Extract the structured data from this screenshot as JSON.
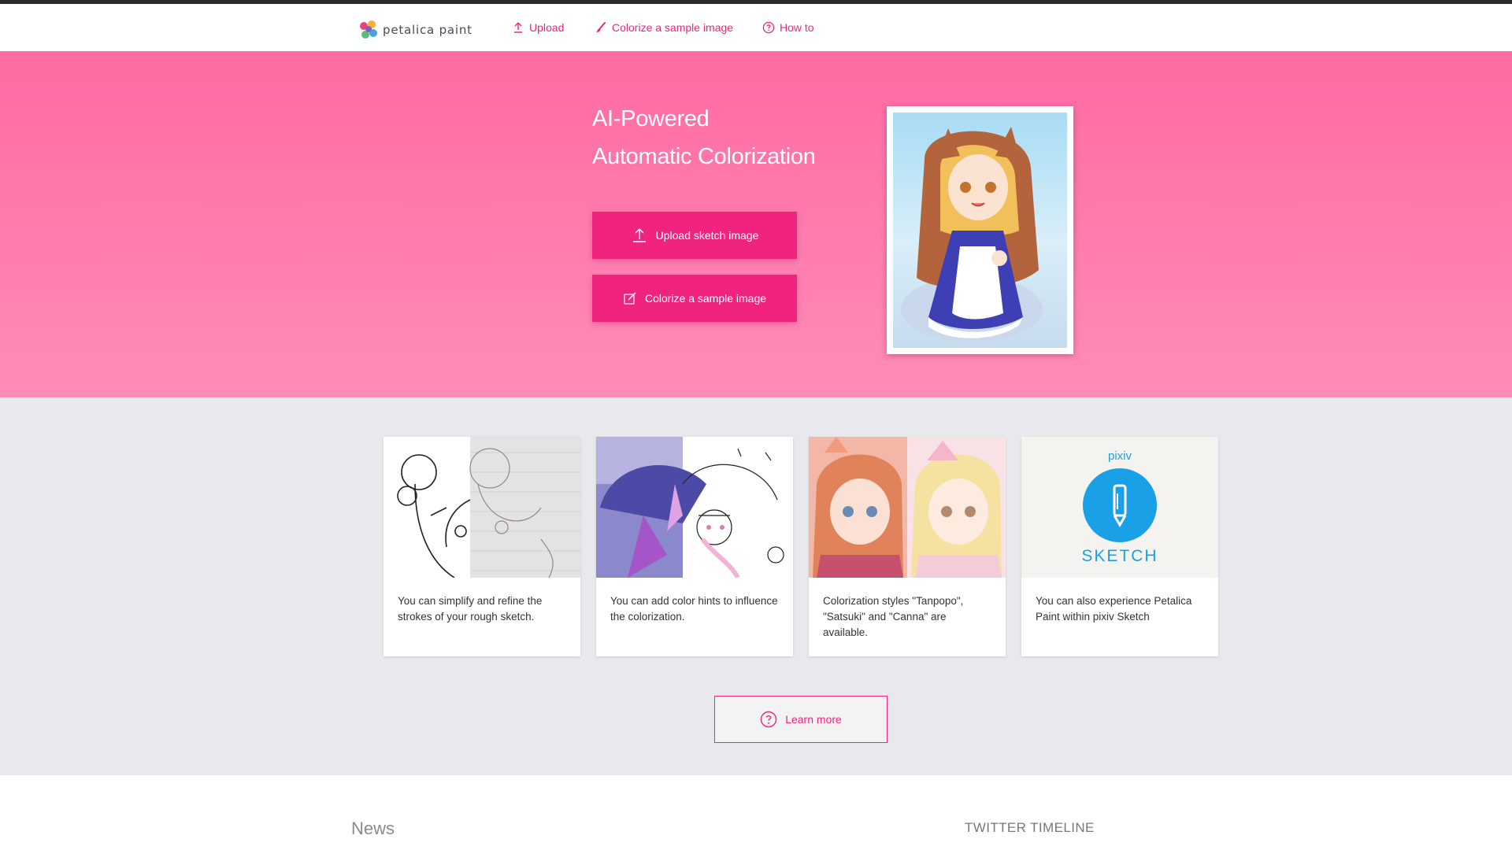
{
  "header": {
    "logo_text": "petalica paint",
    "nav": [
      {
        "label": "Upload",
        "icon": "upload-icon"
      },
      {
        "label": "Colorize a sample image",
        "icon": "brush-icon"
      },
      {
        "label": "How to",
        "icon": "question-circle-icon"
      }
    ]
  },
  "hero": {
    "title_line1": "AI-Powered",
    "title_line2": "Automatic Colorization",
    "upload_button": "Upload sketch image",
    "sample_button": "Colorize a sample image"
  },
  "features": {
    "cards": [
      {
        "text": "You can simplify and refine the strokes of your rough sketch."
      },
      {
        "text": "You can add color hints to influence the colorization."
      },
      {
        "text": "Colorization styles \"Tanpopo\", \"Satsuki\" and \"Canna\" are available."
      },
      {
        "text": "You can also experience Petalica Paint within pixiv Sketch",
        "logo_top": "pixiv",
        "logo_bottom": "SKETCH"
      }
    ],
    "learn_more": "Learn more"
  },
  "bottom": {
    "news_title": "News",
    "twitter_title": "TWITTER TIMELINE"
  },
  "colors": {
    "accent": "#f0247e",
    "hero_top": "#ff6aa3",
    "hero_bottom": "#ff8cb8",
    "features_bg": "#e7e9ec"
  }
}
